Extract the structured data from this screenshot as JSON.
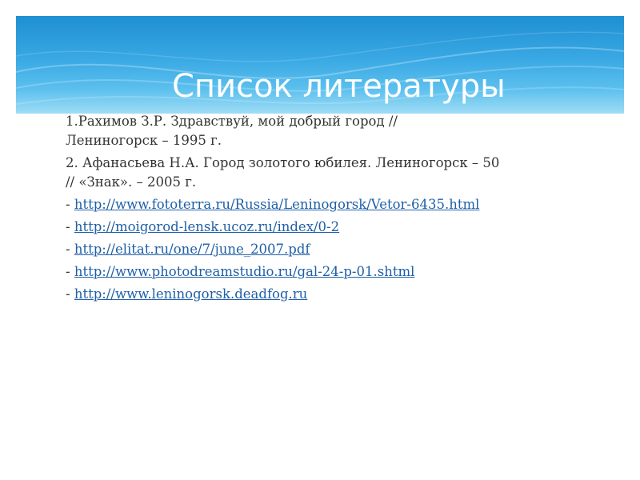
{
  "slide": {
    "title": "Список литературы",
    "references": [
      {
        "line1": "1.Рахимов З.Р. Здравствуй, мой добрый город //",
        "line2": "Лениногорск – 1995 г."
      },
      {
        "line1": "2. Афанасьева Н.А. Город золотого юбилея. Лениногорск – 50",
        "line2": "// «Знак». – 2005 г."
      }
    ],
    "link_prefix": "- ",
    "links": [
      "http://www.fototerra.ru/Russia/Leninogorsk/Vetor-6435.html",
      "http://moigorod-lensk.ucoz.ru/index/0-2",
      "http://elitat.ru/one/7/june_2007.pdf",
      "http://www.photodreamstudio.ru/gal-24-p-01.shtml",
      "http://www.leninogorsk.deadfog.ru"
    ]
  },
  "colors": {
    "header_top": "#1e8fd2",
    "header_bottom": "#9fdcf5",
    "title_text": "#ffffff",
    "body_text": "#333333",
    "link": "#1f5fa8"
  }
}
